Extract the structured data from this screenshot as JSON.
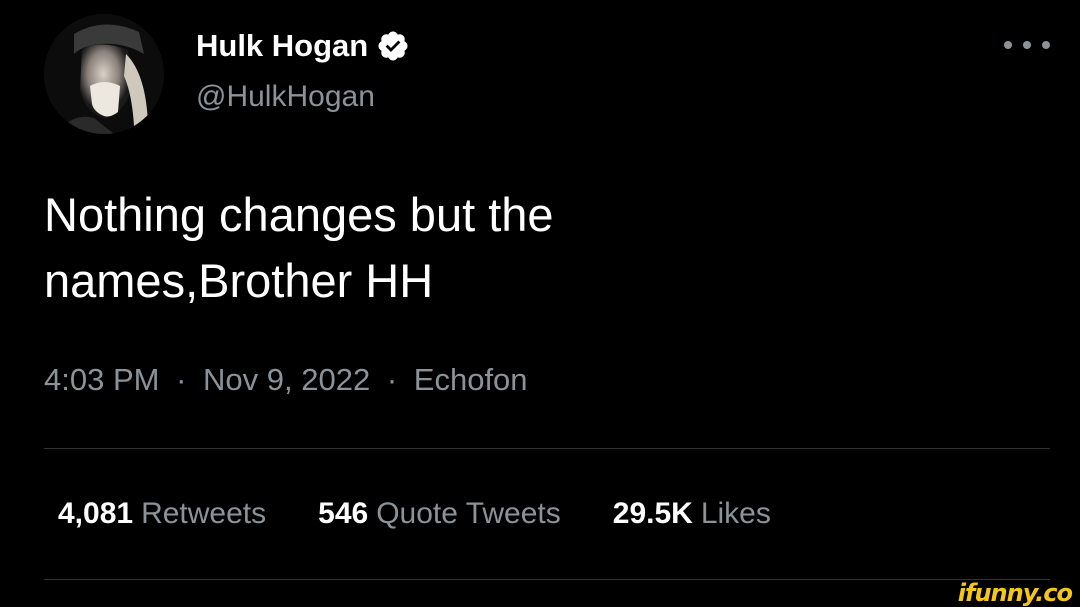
{
  "author": {
    "display_name": "Hulk Hogan",
    "handle": "@HulkHogan",
    "verified": true,
    "avatar_icon": "profile-photo"
  },
  "tweet": {
    "text": "Nothing changes but the\nnames,Brother HH",
    "time": "4:03 PM",
    "separator": "·",
    "date": "Nov 9, 2022",
    "source": "Echofon"
  },
  "stats": {
    "retweets_count": "4,081",
    "retweets_label": "Retweets",
    "quotes_count": "546",
    "quotes_label": "Quote Tweets",
    "likes_count": "29.5K",
    "likes_label": "Likes"
  },
  "watermark": "ifunny.co",
  "colors": {
    "background": "#000000",
    "primary_text": "#ffffff",
    "secondary_text": "#8b9298",
    "verified_badge": "#ffffff",
    "divider": "#2f3336",
    "watermark": "#f5c518"
  },
  "icons": {
    "verified": "verified-badge-icon",
    "more": "more-options-icon"
  }
}
